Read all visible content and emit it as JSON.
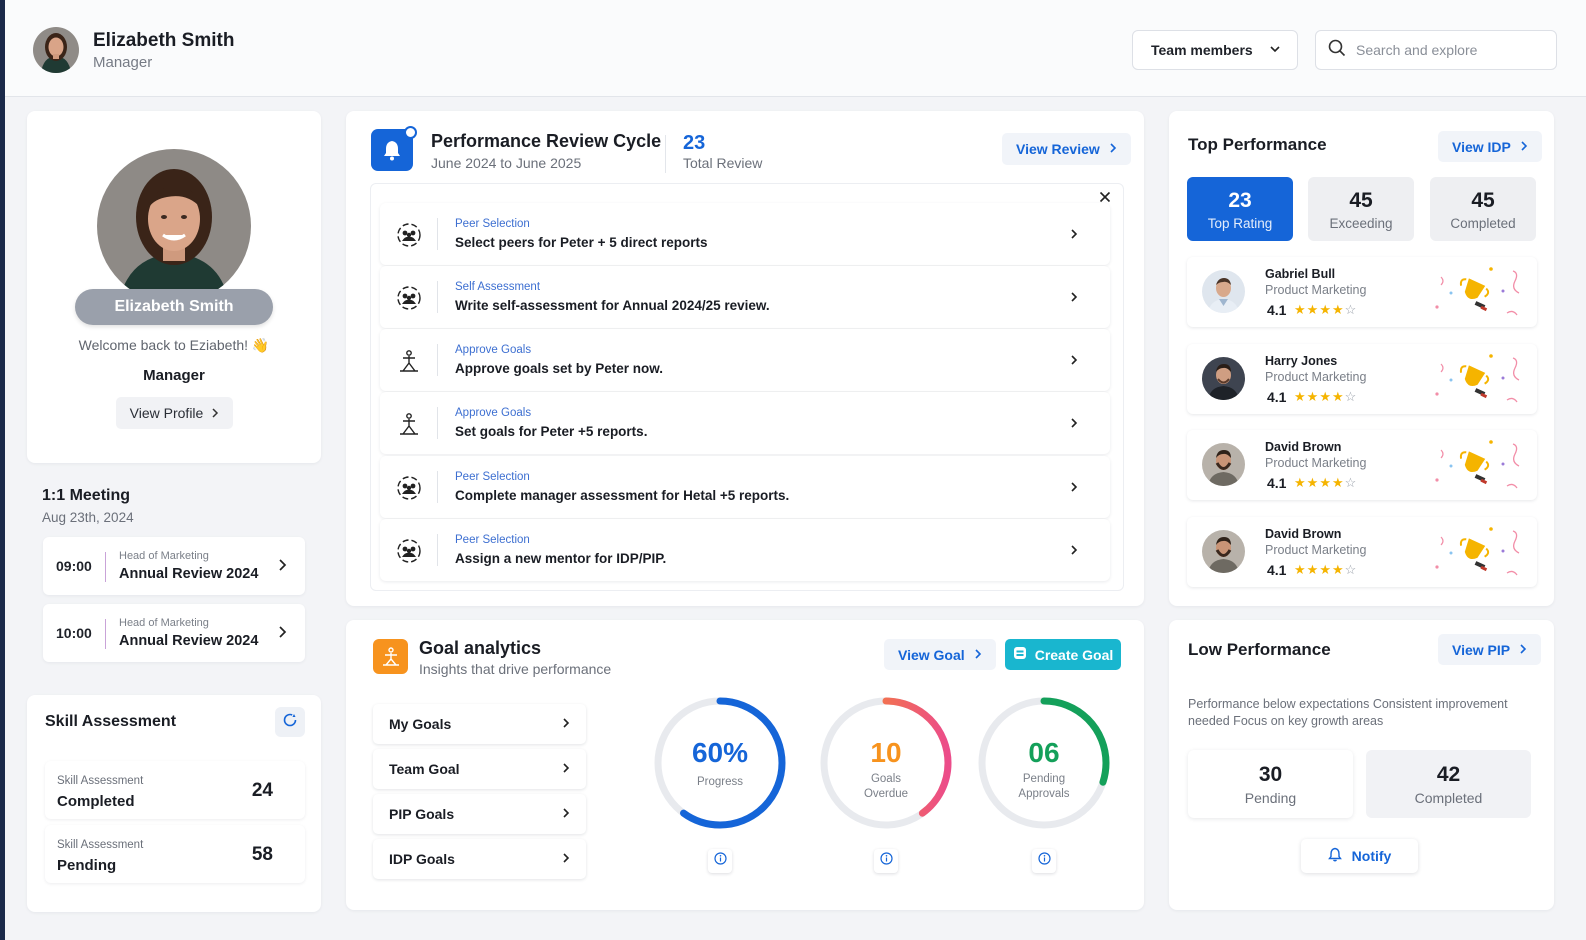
{
  "header": {
    "user_name": "Elizabeth Smith",
    "user_role": "Manager",
    "team_dropdown": "Team members",
    "search_placeholder": "Search and explore"
  },
  "profile": {
    "name": "Elizabeth Smith",
    "welcome": "Welcome back to Eziabeth! 👋",
    "role": "Manager",
    "view_profile": "View Profile"
  },
  "meeting": {
    "title": "1:1 Meeting",
    "date": "Aug 23th, 2024",
    "items": [
      {
        "time": "09:00",
        "sub": "Head of Marketing",
        "title": "Annual Review 2024"
      },
      {
        "time": "10:00",
        "sub": "Head of Marketing",
        "title": "Annual Review 2024"
      }
    ]
  },
  "skill": {
    "title": "Skill Assessment",
    "items": [
      {
        "sub": "Skill Assessment",
        "title": "Completed",
        "value": "24"
      },
      {
        "sub": "Skill Assessment",
        "title": "Pending",
        "value": "58"
      }
    ]
  },
  "review": {
    "title": "Performance Review Cycle",
    "period": "June 2024 to June 2025",
    "count": "23",
    "count_label": "Total Review",
    "view_button": "View Review",
    "tasks": [
      {
        "icon": "people-icon",
        "category": "Peer Selection",
        "text": "Select peers for Peter + 5 direct reports"
      },
      {
        "icon": "people-icon",
        "category": "Self Assessment",
        "text": "Write self-assessment for Annual 2024/25 review."
      },
      {
        "icon": "goal-person-icon",
        "category": "Approve Goals",
        "text": "Approve goals set by Peter now."
      },
      {
        "icon": "goal-person-icon",
        "category": "Approve Goals",
        "text": "Set goals for Peter +5 reports."
      },
      {
        "icon": "people-icon",
        "category": "Peer Selection",
        "text": "Complete manager assessment for Hetal +5 reports."
      },
      {
        "icon": "people-icon",
        "category": "Peer Selection",
        "text": "Assign a new mentor for IDP/PIP."
      }
    ]
  },
  "goals": {
    "title": "Goal analytics",
    "subtitle": "Insights that drive performance",
    "view_button": "View Goal",
    "create_button": "Create Goal",
    "nav": [
      "My Goals",
      "Team Goal",
      "PIP Goals",
      "IDP Goals"
    ],
    "rings": [
      {
        "value": "60%",
        "label1": "Progress",
        "label2": "",
        "fraction": 0.6,
        "color": "#1565d8"
      },
      {
        "value": "10",
        "label1": "Goals",
        "label2": "Overdue",
        "fraction": 0.4,
        "color": "#f7931e"
      },
      {
        "value": "06",
        "label1": "Pending",
        "label2": "Approvals",
        "fraction": 0.3,
        "color": "#14a05a"
      }
    ]
  },
  "top_performance": {
    "title": "Top Performance",
    "view_button": "View IDP",
    "stats": [
      {
        "value": "23",
        "label": "Top Rating"
      },
      {
        "value": "45",
        "label": "Exceeding"
      },
      {
        "value": "45",
        "label": "Completed"
      }
    ],
    "people": [
      {
        "name": "Gabriel Bull",
        "role": "Product Marketing",
        "score": "4.1",
        "stars": 4
      },
      {
        "name": "Harry Jones",
        "role": "Product Marketing",
        "score": "4.1",
        "stars": 4
      },
      {
        "name": "David Brown",
        "role": "Product Marketing",
        "score": "4.1",
        "stars": 4
      },
      {
        "name": "David Brown",
        "role": "Product Marketing",
        "score": "4.1",
        "stars": 4
      }
    ]
  },
  "low_performance": {
    "title": "Low Performance",
    "view_button": "View PIP",
    "description": "Performance below expectations Consistent improvement needed Focus on key growth areas",
    "stats": [
      {
        "value": "30",
        "label": "Pending"
      },
      {
        "value": "42",
        "label": "Completed"
      }
    ],
    "notify_button": "Notify"
  },
  "colors": {
    "accent": "#1565d8",
    "create": "#19b6cf",
    "goal_icon": "#f7931e",
    "star": "#f5b400"
  }
}
